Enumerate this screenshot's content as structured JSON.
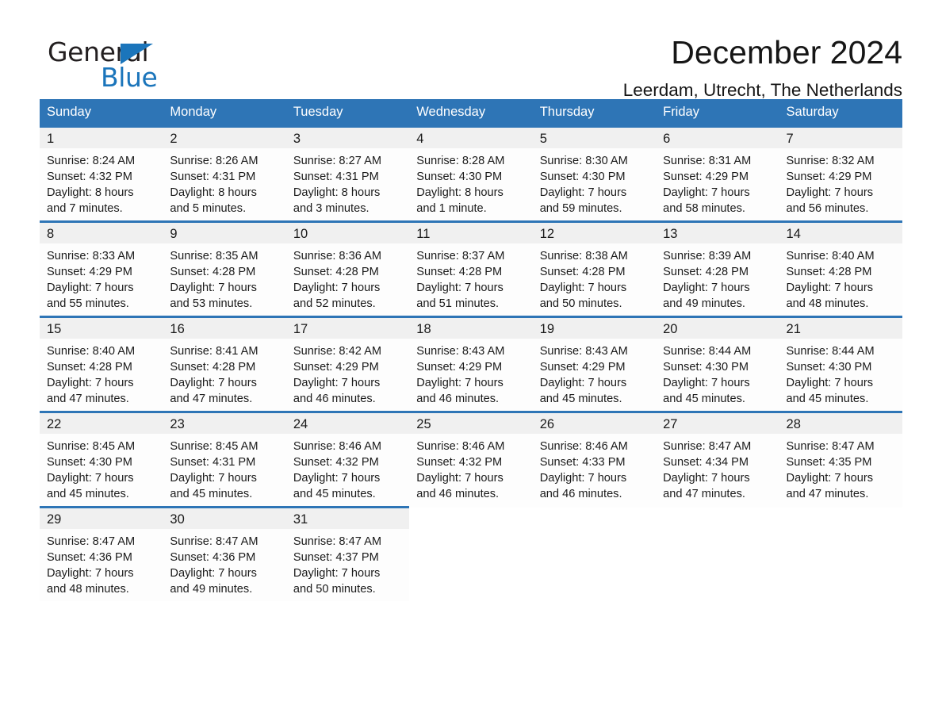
{
  "brand": {
    "name_part1": "General",
    "name_part2": "Blue",
    "triangle_color": "#1b75bb"
  },
  "header": {
    "title": "December 2024",
    "location": "Leerdam, Utrecht, The Netherlands"
  },
  "theme": {
    "header_blue": "#2e75b6",
    "daynum_band": "#f0f0f0",
    "cell_bg": "#fdfdfd",
    "text": "#1a1a1a"
  },
  "weekday_headers": [
    "Sunday",
    "Monday",
    "Tuesday",
    "Wednesday",
    "Thursday",
    "Friday",
    "Saturday"
  ],
  "labels": {
    "sunrise_prefix": "Sunrise:",
    "sunset_prefix": "Sunset:",
    "daylight_prefix": "Daylight:"
  },
  "weeks": [
    [
      {
        "day": "1",
        "line1": "Sunrise: 8:24 AM",
        "line2": "Sunset: 4:32 PM",
        "line3": "Daylight: 8 hours",
        "line4": "and 7 minutes."
      },
      {
        "day": "2",
        "line1": "Sunrise: 8:26 AM",
        "line2": "Sunset: 4:31 PM",
        "line3": "Daylight: 8 hours",
        "line4": "and 5 minutes."
      },
      {
        "day": "3",
        "line1": "Sunrise: 8:27 AM",
        "line2": "Sunset: 4:31 PM",
        "line3": "Daylight: 8 hours",
        "line4": "and 3 minutes."
      },
      {
        "day": "4",
        "line1": "Sunrise: 8:28 AM",
        "line2": "Sunset: 4:30 PM",
        "line3": "Daylight: 8 hours",
        "line4": "and 1 minute."
      },
      {
        "day": "5",
        "line1": "Sunrise: 8:30 AM",
        "line2": "Sunset: 4:30 PM",
        "line3": "Daylight: 7 hours",
        "line4": "and 59 minutes."
      },
      {
        "day": "6",
        "line1": "Sunrise: 8:31 AM",
        "line2": "Sunset: 4:29 PM",
        "line3": "Daylight: 7 hours",
        "line4": "and 58 minutes."
      },
      {
        "day": "7",
        "line1": "Sunrise: 8:32 AM",
        "line2": "Sunset: 4:29 PM",
        "line3": "Daylight: 7 hours",
        "line4": "and 56 minutes."
      }
    ],
    [
      {
        "day": "8",
        "line1": "Sunrise: 8:33 AM",
        "line2": "Sunset: 4:29 PM",
        "line3": "Daylight: 7 hours",
        "line4": "and 55 minutes."
      },
      {
        "day": "9",
        "line1": "Sunrise: 8:35 AM",
        "line2": "Sunset: 4:28 PM",
        "line3": "Daylight: 7 hours",
        "line4": "and 53 minutes."
      },
      {
        "day": "10",
        "line1": "Sunrise: 8:36 AM",
        "line2": "Sunset: 4:28 PM",
        "line3": "Daylight: 7 hours",
        "line4": "and 52 minutes."
      },
      {
        "day": "11",
        "line1": "Sunrise: 8:37 AM",
        "line2": "Sunset: 4:28 PM",
        "line3": "Daylight: 7 hours",
        "line4": "and 51 minutes."
      },
      {
        "day": "12",
        "line1": "Sunrise: 8:38 AM",
        "line2": "Sunset: 4:28 PM",
        "line3": "Daylight: 7 hours",
        "line4": "and 50 minutes."
      },
      {
        "day": "13",
        "line1": "Sunrise: 8:39 AM",
        "line2": "Sunset: 4:28 PM",
        "line3": "Daylight: 7 hours",
        "line4": "and 49 minutes."
      },
      {
        "day": "14",
        "line1": "Sunrise: 8:40 AM",
        "line2": "Sunset: 4:28 PM",
        "line3": "Daylight: 7 hours",
        "line4": "and 48 minutes."
      }
    ],
    [
      {
        "day": "15",
        "line1": "Sunrise: 8:40 AM",
        "line2": "Sunset: 4:28 PM",
        "line3": "Daylight: 7 hours",
        "line4": "and 47 minutes."
      },
      {
        "day": "16",
        "line1": "Sunrise: 8:41 AM",
        "line2": "Sunset: 4:28 PM",
        "line3": "Daylight: 7 hours",
        "line4": "and 47 minutes."
      },
      {
        "day": "17",
        "line1": "Sunrise: 8:42 AM",
        "line2": "Sunset: 4:29 PM",
        "line3": "Daylight: 7 hours",
        "line4": "and 46 minutes."
      },
      {
        "day": "18",
        "line1": "Sunrise: 8:43 AM",
        "line2": "Sunset: 4:29 PM",
        "line3": "Daylight: 7 hours",
        "line4": "and 46 minutes."
      },
      {
        "day": "19",
        "line1": "Sunrise: 8:43 AM",
        "line2": "Sunset: 4:29 PM",
        "line3": "Daylight: 7 hours",
        "line4": "and 45 minutes."
      },
      {
        "day": "20",
        "line1": "Sunrise: 8:44 AM",
        "line2": "Sunset: 4:30 PM",
        "line3": "Daylight: 7 hours",
        "line4": "and 45 minutes."
      },
      {
        "day": "21",
        "line1": "Sunrise: 8:44 AM",
        "line2": "Sunset: 4:30 PM",
        "line3": "Daylight: 7 hours",
        "line4": "and 45 minutes."
      }
    ],
    [
      {
        "day": "22",
        "line1": "Sunrise: 8:45 AM",
        "line2": "Sunset: 4:30 PM",
        "line3": "Daylight: 7 hours",
        "line4": "and 45 minutes."
      },
      {
        "day": "23",
        "line1": "Sunrise: 8:45 AM",
        "line2": "Sunset: 4:31 PM",
        "line3": "Daylight: 7 hours",
        "line4": "and 45 minutes."
      },
      {
        "day": "24",
        "line1": "Sunrise: 8:46 AM",
        "line2": "Sunset: 4:32 PM",
        "line3": "Daylight: 7 hours",
        "line4": "and 45 minutes."
      },
      {
        "day": "25",
        "line1": "Sunrise: 8:46 AM",
        "line2": "Sunset: 4:32 PM",
        "line3": "Daylight: 7 hours",
        "line4": "and 46 minutes."
      },
      {
        "day": "26",
        "line1": "Sunrise: 8:46 AM",
        "line2": "Sunset: 4:33 PM",
        "line3": "Daylight: 7 hours",
        "line4": "and 46 minutes."
      },
      {
        "day": "27",
        "line1": "Sunrise: 8:47 AM",
        "line2": "Sunset: 4:34 PM",
        "line3": "Daylight: 7 hours",
        "line4": "and 47 minutes."
      },
      {
        "day": "28",
        "line1": "Sunrise: 8:47 AM",
        "line2": "Sunset: 4:35 PM",
        "line3": "Daylight: 7 hours",
        "line4": "and 47 minutes."
      }
    ],
    [
      {
        "day": "29",
        "line1": "Sunrise: 8:47 AM",
        "line2": "Sunset: 4:36 PM",
        "line3": "Daylight: 7 hours",
        "line4": "and 48 minutes."
      },
      {
        "day": "30",
        "line1": "Sunrise: 8:47 AM",
        "line2": "Sunset: 4:36 PM",
        "line3": "Daylight: 7 hours",
        "line4": "and 49 minutes."
      },
      {
        "day": "31",
        "line1": "Sunrise: 8:47 AM",
        "line2": "Sunset: 4:37 PM",
        "line3": "Daylight: 7 hours",
        "line4": "and 50 minutes."
      },
      {
        "day": "",
        "line1": "",
        "line2": "",
        "line3": "",
        "line4": ""
      },
      {
        "day": "",
        "line1": "",
        "line2": "",
        "line3": "",
        "line4": ""
      },
      {
        "day": "",
        "line1": "",
        "line2": "",
        "line3": "",
        "line4": ""
      },
      {
        "day": "",
        "line1": "",
        "line2": "",
        "line3": "",
        "line4": ""
      }
    ]
  ]
}
